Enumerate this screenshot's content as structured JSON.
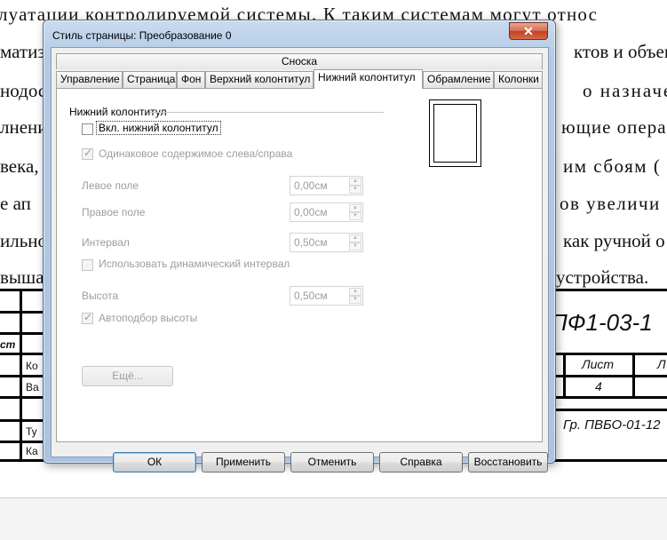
{
  "document": {
    "lines": [
      "луатации контролируемой системы. К таким системам могут относ",
      "матиз",
      "нодос",
      "лнени",
      "века,",
      "е ап",
      "ильно",
      "выша"
    ],
    "right_fragments": [
      "ктов и объен",
      "о назначен",
      "ющие опера",
      "им сбоям (",
      "ов увеличи",
      "как ручной о",
      "устройства."
    ],
    "stamp_code": "ПФ1-03-1",
    "stamp_group": "Гр. ПВБО-01-12",
    "stamp_list": "Лист",
    "stamp_list2": "Л",
    "stamp_sheet_no": "4",
    "stamp_left_labels": [
      "ст",
      "Ко",
      "Ва",
      "Ту",
      "Ка"
    ]
  },
  "dialog": {
    "title": "Стиль страницы: Преобразование 0",
    "close_glyph": "✕",
    "section_header": "Сноска",
    "tabs": [
      {
        "label": "Управление"
      },
      {
        "label": "Страница"
      },
      {
        "label": "Фон"
      },
      {
        "label": "Верхний колонтитул"
      },
      {
        "label": "Нижний колонтитул",
        "active": true
      },
      {
        "label": "Обрамление"
      },
      {
        "label": "Колонки"
      }
    ],
    "group_title": "Нижний колонтитул",
    "enable_footer": {
      "label": "Вкл. нижний колонтитул",
      "checked": false
    },
    "same_content": {
      "label": "Одинаковое содержимое слева/справа",
      "checked": true
    },
    "left_margin": {
      "label": "Левое поле",
      "value": "0,00см"
    },
    "right_margin": {
      "label": "Правое поле",
      "value": "0,00см"
    },
    "spacing": {
      "label": "Интервал",
      "value": "0,50см"
    },
    "dynamic_spacing": {
      "label": "Использовать динамический интервал",
      "checked": false
    },
    "height": {
      "label": "Высота",
      "value": "0,50см"
    },
    "autofit_height": {
      "label": "Автоподбор высоты",
      "checked": true
    },
    "more_button": "Ещё...",
    "buttons": {
      "ok": "ОК",
      "apply": "Применить",
      "cancel": "Отменить",
      "help": "Справка",
      "reset": "Восстановить"
    },
    "spin_up_glyph": "▲",
    "spin_down_glyph": "▼",
    "icons": {
      "close": "close-icon",
      "spin_up": "spin-up-icon",
      "spin_down": "spin-down-icon",
      "check": "checkmark-icon"
    }
  }
}
